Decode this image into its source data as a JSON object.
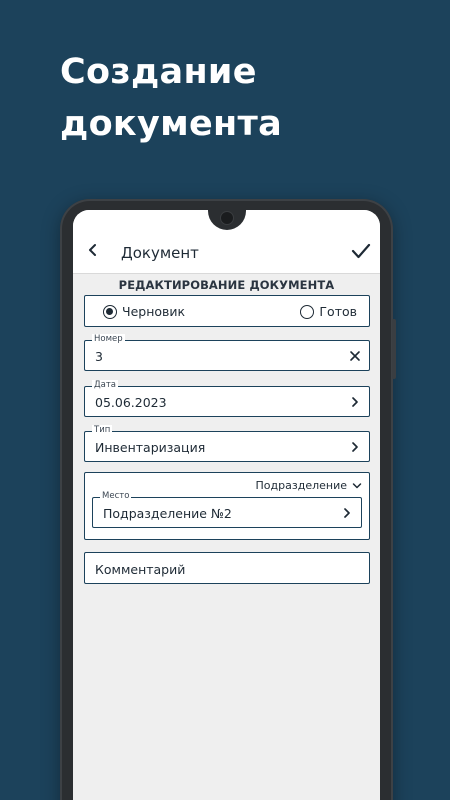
{
  "promo": {
    "title_line1": "Создание",
    "title_line2": "документа"
  },
  "appbar": {
    "back_icon": "chevron-left-icon",
    "title": "Документ",
    "confirm_icon": "check-icon"
  },
  "section_title": "РЕДАКТИРОВАНИЕ ДОКУМЕНТА",
  "status": {
    "options": [
      {
        "label": "Черновик",
        "selected": true
      },
      {
        "label": "Готов",
        "selected": false
      }
    ]
  },
  "fields": {
    "number": {
      "label": "Номер",
      "value": "3",
      "icon": "clear-icon"
    },
    "date": {
      "label": "Дата",
      "value": "05.06.2023",
      "icon": "chevron-right-icon"
    },
    "type": {
      "label": "Тип",
      "value": "Инвентаризация",
      "icon": "chevron-right-icon"
    }
  },
  "department": {
    "header": "Подразделение",
    "header_icon": "chevron-down-icon",
    "place_label": "Место",
    "place_value": "Подразделение №2",
    "place_icon": "chevron-right-icon"
  },
  "comment": {
    "placeholder": "Комментарий"
  },
  "colors": {
    "background": "#1c425b",
    "accent": "#1c425b",
    "screen": "#efefef",
    "text": "#1e2a35"
  }
}
